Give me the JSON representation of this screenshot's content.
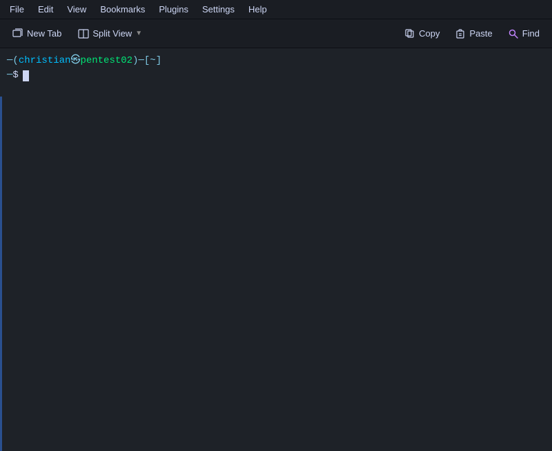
{
  "menubar": {
    "items": [
      {
        "label": "File",
        "id": "file"
      },
      {
        "label": "Edit",
        "id": "edit"
      },
      {
        "label": "View",
        "id": "view"
      },
      {
        "label": "Bookmarks",
        "id": "bookmarks"
      },
      {
        "label": "Plugins",
        "id": "plugins"
      },
      {
        "label": "Settings",
        "id": "settings"
      },
      {
        "label": "Help",
        "id": "help"
      }
    ]
  },
  "toolbar": {
    "new_tab_label": "New Tab",
    "split_view_label": "Split View",
    "copy_label": "Copy",
    "paste_label": "Paste",
    "find_label": "Find"
  },
  "terminal": {
    "prompt_dash": "─(",
    "prompt_user": "christian",
    "prompt_at": "㉿",
    "prompt_host": "pentest02",
    "prompt_paren_close": ")─[",
    "prompt_path": "~",
    "prompt_bracket_close": "]",
    "prompt_newline_dash": "─$",
    "prompt_dollar": "$"
  }
}
